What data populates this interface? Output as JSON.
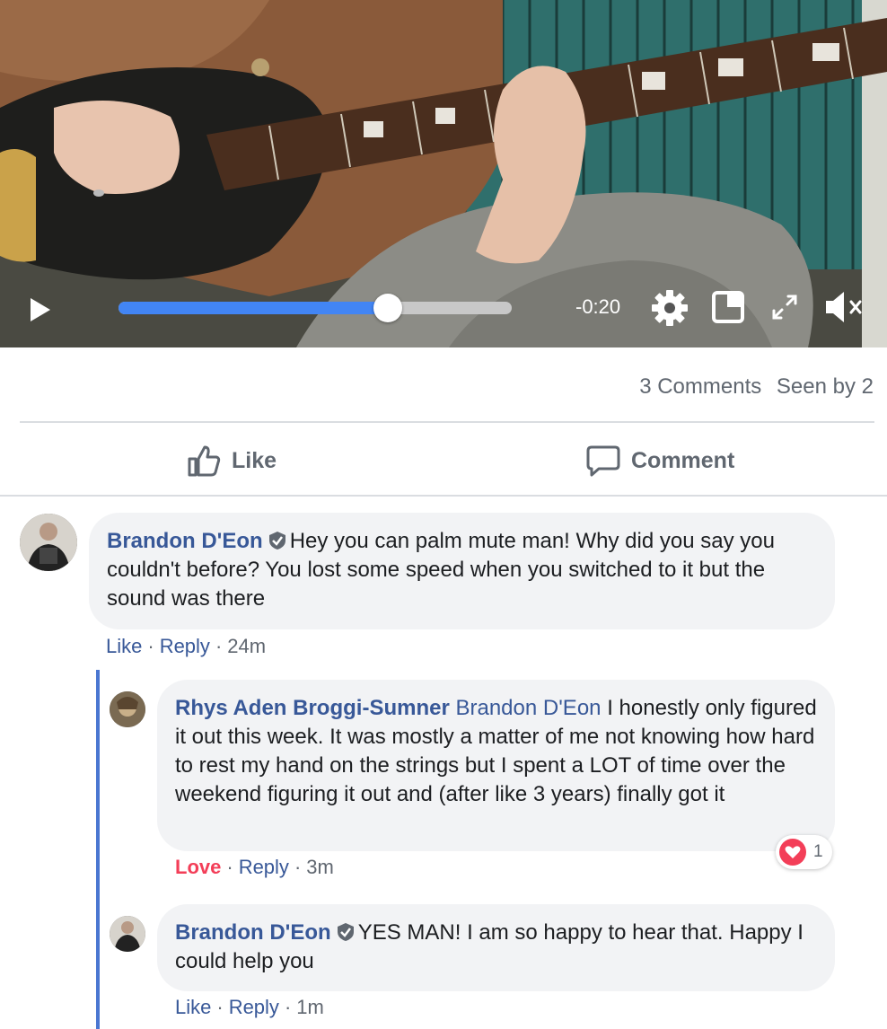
{
  "video": {
    "time_remaining": "-0:20",
    "progress": 0.685,
    "icons": [
      "play-icon",
      "gear-icon",
      "popout-icon",
      "expand-icon",
      "mute-icon"
    ]
  },
  "stats": {
    "comments": "3 Comments",
    "seen_by": "Seen by 2"
  },
  "actions": {
    "like": "Like",
    "comment": "Comment"
  },
  "comments": [
    {
      "author": "Brandon D'Eon",
      "verified": true,
      "text": "Hey you can palm mute man! Why did you say you couldn't before? You lost some speed when you switched to it but the sound was there",
      "like": "Like",
      "reply": "Reply",
      "time": "24m"
    },
    {
      "author": "Rhys Aden Broggi-Sumner",
      "mention": "Brandon D'Eon",
      "text": "I honestly only figured it out this week. It was mostly a matter of me not knowing how hard to rest my hand on the strings but I spent a LOT of time over the weekend figuring it out and (after like 3 years) finally got it",
      "like": "Love",
      "reply": "Reply",
      "time": "3m",
      "reaction_count": "1"
    },
    {
      "author": "Brandon D'Eon",
      "verified": true,
      "text": "YES MAN! I am so happy to hear that. Happy I could help you",
      "like": "Like",
      "reply": "Reply",
      "time": "1m"
    }
  ],
  "colors": {
    "link": "#385898",
    "love": "#f33e58",
    "progress": "#4285f4",
    "thread_line": "#4a76d1"
  }
}
